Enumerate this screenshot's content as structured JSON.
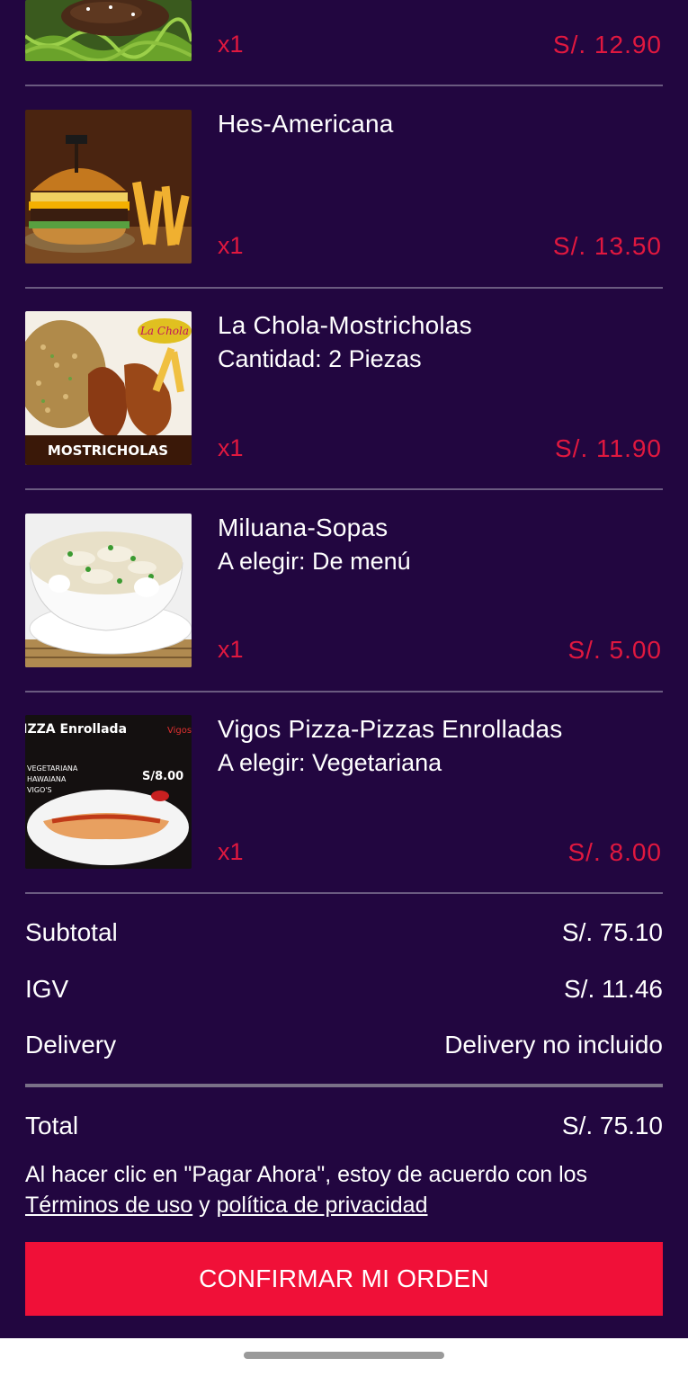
{
  "cart": {
    "items": [
      {
        "name": "",
        "option": "",
        "qty": "x1",
        "price": "S/. 12.90",
        "image": "spaghetti-with-meat-photo"
      },
      {
        "name": "Hes-Americana",
        "option": "",
        "qty": "x1",
        "price": "S/. 13.50",
        "image": "burger-with-fries-photo"
      },
      {
        "name": "La Chola-Mostricholas",
        "option": "Cantidad: 2 Piezas",
        "qty": "x1",
        "price": "S/. 11.90",
        "image": "fried-chicken-rice-photo",
        "image_text": "MOSTRICHOLAS"
      },
      {
        "name": "Miluana-Sopas",
        "option": "A elegir: De menú",
        "qty": "x1",
        "price": "S/. 5.00",
        "image": "soup-bowl-photo"
      },
      {
        "name": "Vigos Pizza-Pizzas Enrolladas",
        "option": "A elegir: Vegetariana",
        "qty": "x1",
        "price": "S/. 8.00",
        "image": "rolled-pizza-photo",
        "image_text": "PIZZA Enrollada"
      }
    ]
  },
  "summary": {
    "subtotal_label": "Subtotal",
    "subtotal_value": "S/. 75.10",
    "igv_label": "IGV",
    "igv_value": "S/. 11.46",
    "delivery_label": "Delivery",
    "delivery_value": "Delivery no incluido",
    "total_label": "Total",
    "total_value": "S/. 75.10"
  },
  "terms": {
    "prefix": "Al hacer clic en \"Pagar Ahora\", estoy de acuerdo con los",
    "terms_link": "Términos de uso",
    "connector": " y ",
    "privacy_link": "política de privacidad"
  },
  "confirm_button": "CONFIRMAR MI ORDEN",
  "colors": {
    "background": "#220640",
    "accent": "#f01038",
    "price": "#e0183f",
    "text": "#ffffff"
  }
}
